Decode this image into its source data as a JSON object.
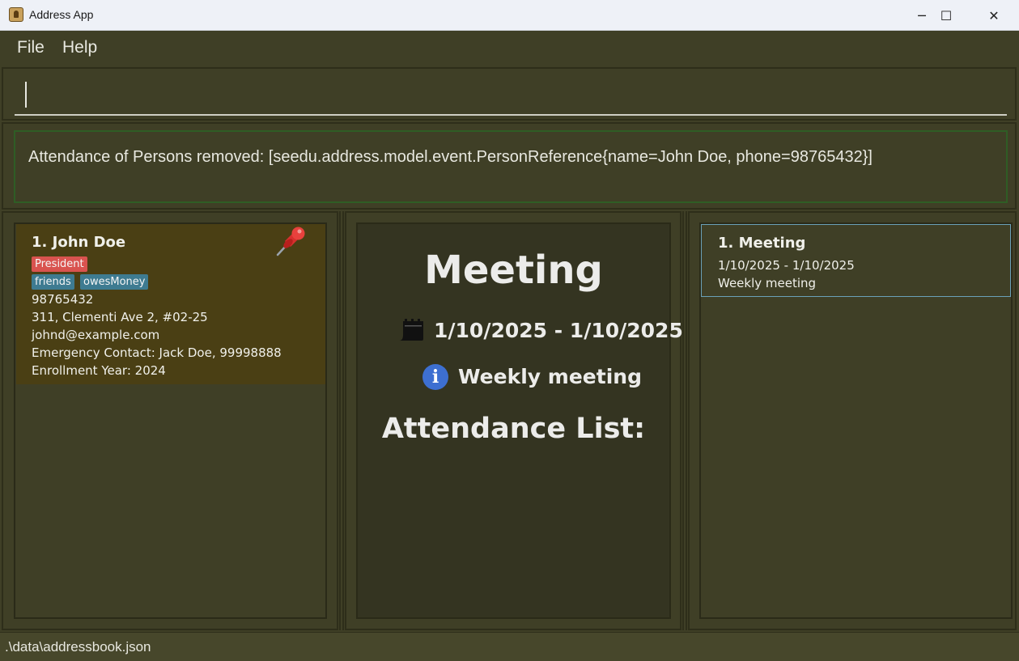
{
  "window": {
    "title": "Address App",
    "minimize": "─",
    "maximize": "☐",
    "close": "✕"
  },
  "menu": {
    "file": "File",
    "help": "Help"
  },
  "command": {
    "value": "",
    "placeholder": ""
  },
  "result": {
    "message": "Attendance of Persons removed: [seedu.address.model.event.PersonReference{name=John Doe, phone=98765432}]"
  },
  "persons": [
    {
      "index_name": "1. John Doe",
      "pinned": true,
      "role_tag": "President",
      "tags": [
        "friends",
        "owesMoney"
      ],
      "phone": "98765432",
      "address": "311, Clementi Ave 2, #02-25",
      "email": "johnd@example.com",
      "emergency": "Emergency Contact: Jack Doe, 99998888",
      "enrollment": "Enrollment Year: 2024"
    }
  ],
  "event_detail": {
    "title": "Meeting",
    "date_range": "1/10/2025 - 1/10/2025",
    "description": "Weekly meeting",
    "attendance_heading": "Attendance List:"
  },
  "events": [
    {
      "index_name": "1. Meeting",
      "date_range": "1/10/2025 - 1/10/2025",
      "description": "Weekly meeting"
    }
  ],
  "status": {
    "path": ".\\data\\addressbook.json"
  },
  "colors": {
    "background": "#3f3f26",
    "person_card": "#4a3f14",
    "role_tag": "#d9534f",
    "tag": "#3e7b91",
    "info_icon": "#3d6fd1",
    "result_border": "#2f5d25",
    "event_selected_border": "#6aa1b8"
  }
}
